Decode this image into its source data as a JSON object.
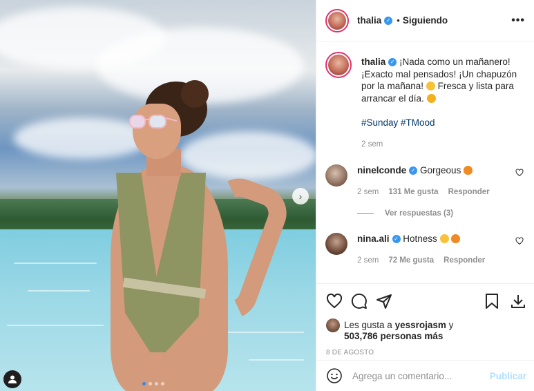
{
  "header": {
    "username": "thalia",
    "separator": "•",
    "follow_status": "Siguiendo",
    "more": "•••"
  },
  "photo": {
    "next_arrow": "›"
  },
  "caption": {
    "username": "thalia",
    "text_1": "¡Nada como un mañanero! ¡Exacto mal pensados! ¡Un chapuzón por la mañana!",
    "text_2": "Fresca y lista para arrancar el día.",
    "hashtags": "#Sunday #TMood",
    "time": "2 sem"
  },
  "comments": [
    {
      "username": "ninelconde",
      "text": "Gorgeous",
      "time": "2 sem",
      "likes": "131 Me gusta",
      "reply": "Responder",
      "view_replies": "Ver respuestas (3)"
    },
    {
      "username": "nina.ali",
      "text": "Hotness",
      "time": "2 sem",
      "likes": "72 Me gusta",
      "reply": "Responder"
    }
  ],
  "likes": {
    "prefix": "Les gusta a",
    "user": "yessrojasm",
    "conj": "y",
    "count": "503,786 personas más"
  },
  "date": "8 DE AGOSTO",
  "add_comment": {
    "placeholder": "Agrega un comentario...",
    "post": "Publicar"
  },
  "colors": {
    "verified": "#3897f0",
    "story_ring": "#e1306c",
    "hashtag": "#00376b",
    "post_disabled": "#b2dffc"
  }
}
